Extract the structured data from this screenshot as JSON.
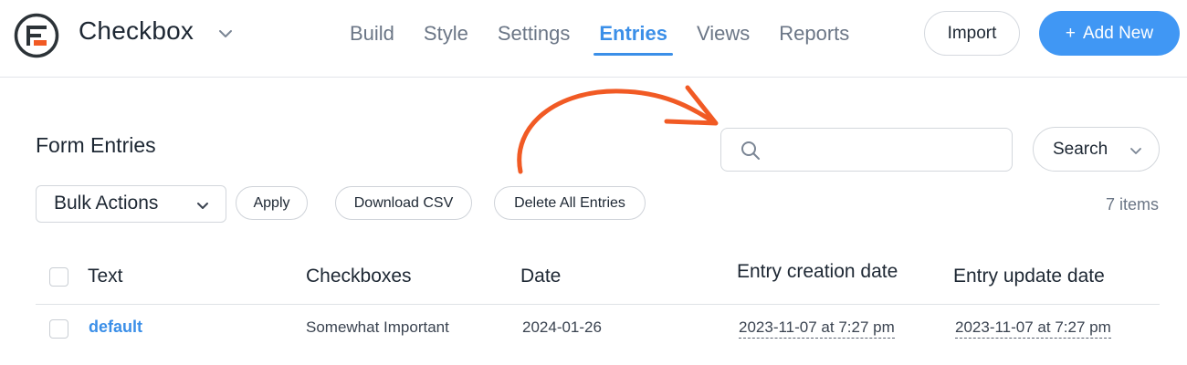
{
  "header": {
    "app_title": "Checkbox",
    "nav": [
      {
        "label": "Build"
      },
      {
        "label": "Style"
      },
      {
        "label": "Settings"
      },
      {
        "label": "Entries"
      },
      {
        "label": "Views"
      },
      {
        "label": "Reports"
      }
    ],
    "active_nav": "Entries",
    "import_label": "Import",
    "add_new_label": "Add New",
    "add_new_prefix": "+"
  },
  "page": {
    "title": "Form Entries"
  },
  "search": {
    "value": "",
    "placeholder": "",
    "dropdown_label": "Search"
  },
  "toolbar": {
    "bulk_actions_label": "Bulk Actions",
    "apply_label": "Apply",
    "download_csv_label": "Download CSV",
    "delete_all_label": "Delete All Entries",
    "items_count": "7 items"
  },
  "table": {
    "columns": [
      "Text",
      "Checkboxes",
      "Date",
      "Entry creation date",
      "Entry update date"
    ],
    "rows": [
      {
        "text": "default",
        "checkboxes": "Somewhat Important",
        "date": "2024-01-26",
        "created": "2023-11-07 at 7:27 pm",
        "updated": "2023-11-07 at 7:27 pm"
      }
    ]
  },
  "colors": {
    "accent": "#4097f4",
    "annotation_arrow": "#f15a24",
    "logo_mark": "#f15a24"
  }
}
